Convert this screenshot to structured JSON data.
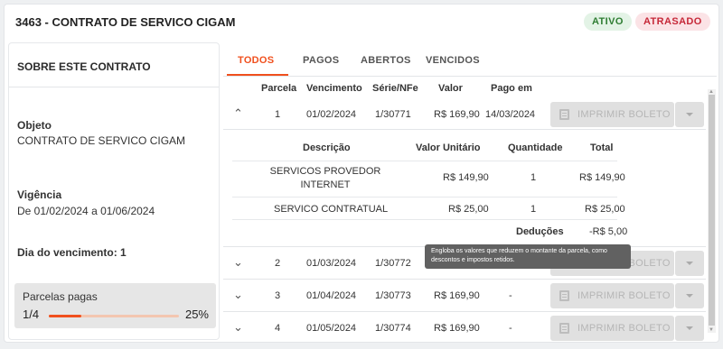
{
  "contract": {
    "title": "3463 - CONTRATO DE SERVICO CIGAM",
    "status_active": "ATIVO",
    "status_late": "ATRASADO"
  },
  "about": {
    "heading": "SOBRE ESTE CONTRATO",
    "objeto_label": "Objeto",
    "objeto_value": "CONTRATO DE SERVICO CIGAM",
    "vigencia_label": "Vigência",
    "vigencia_value": "De 01/02/2024 a 01/06/2024",
    "vencimento": "Dia do vencimento: 1",
    "parcelas_label": "Parcelas pagas",
    "parcelas_fraction": "1/4",
    "parcelas_percent": "25%",
    "progress_fraction": 0.25
  },
  "tabs": [
    "TODOS",
    "PAGOS",
    "ABERTOS",
    "VENCIDOS"
  ],
  "table": {
    "headers": [
      "Parcela",
      "Vencimento",
      "Série/NFe",
      "Valor",
      "Pago em"
    ],
    "rows": [
      {
        "parcela": "1",
        "vencimento": "01/02/2024",
        "serie": "1/30771",
        "valor": "R$ 169,90",
        "pago": "14/03/2024",
        "icon": "chevron-up-icon"
      },
      {
        "parcela": "2",
        "vencimento": "01/03/2024",
        "serie": "1/30772",
        "valor": "",
        "pago": "",
        "icon": "chevron-down-icon"
      },
      {
        "parcela": "3",
        "vencimento": "01/04/2024",
        "serie": "1/30773",
        "valor": "R$ 169,90",
        "pago": "-",
        "icon": "chevron-down-icon"
      },
      {
        "parcela": "4",
        "vencimento": "01/05/2024",
        "serie": "1/30774",
        "valor": "R$ 169,90",
        "pago": "-",
        "icon": "chevron-down-icon"
      }
    ],
    "print_label": "IMPRIMIR BOLETO"
  },
  "detail": {
    "headers": [
      "Descrição",
      "Valor Unitário",
      "Quantidade",
      "Total"
    ],
    "items": [
      {
        "desc": "SERVICOS PROVEDOR INTERNET",
        "unit": "R$ 149,90",
        "qty": "1",
        "total": "R$ 149,90"
      },
      {
        "desc": "SERVICO CONTRATUAL",
        "unit": "R$ 25,00",
        "qty": "1",
        "total": "R$ 25,00"
      }
    ],
    "deducoes_label": "Deduções",
    "deducoes_value": "-R$ 5,00"
  },
  "tooltip": "Engloba os valores que reduzem o montante da parcela, como descontos e impostos retidos.",
  "colors": {
    "accent": "#f0501e",
    "active_bg": "#e3f3e6",
    "late_bg": "#fbe3e6"
  }
}
